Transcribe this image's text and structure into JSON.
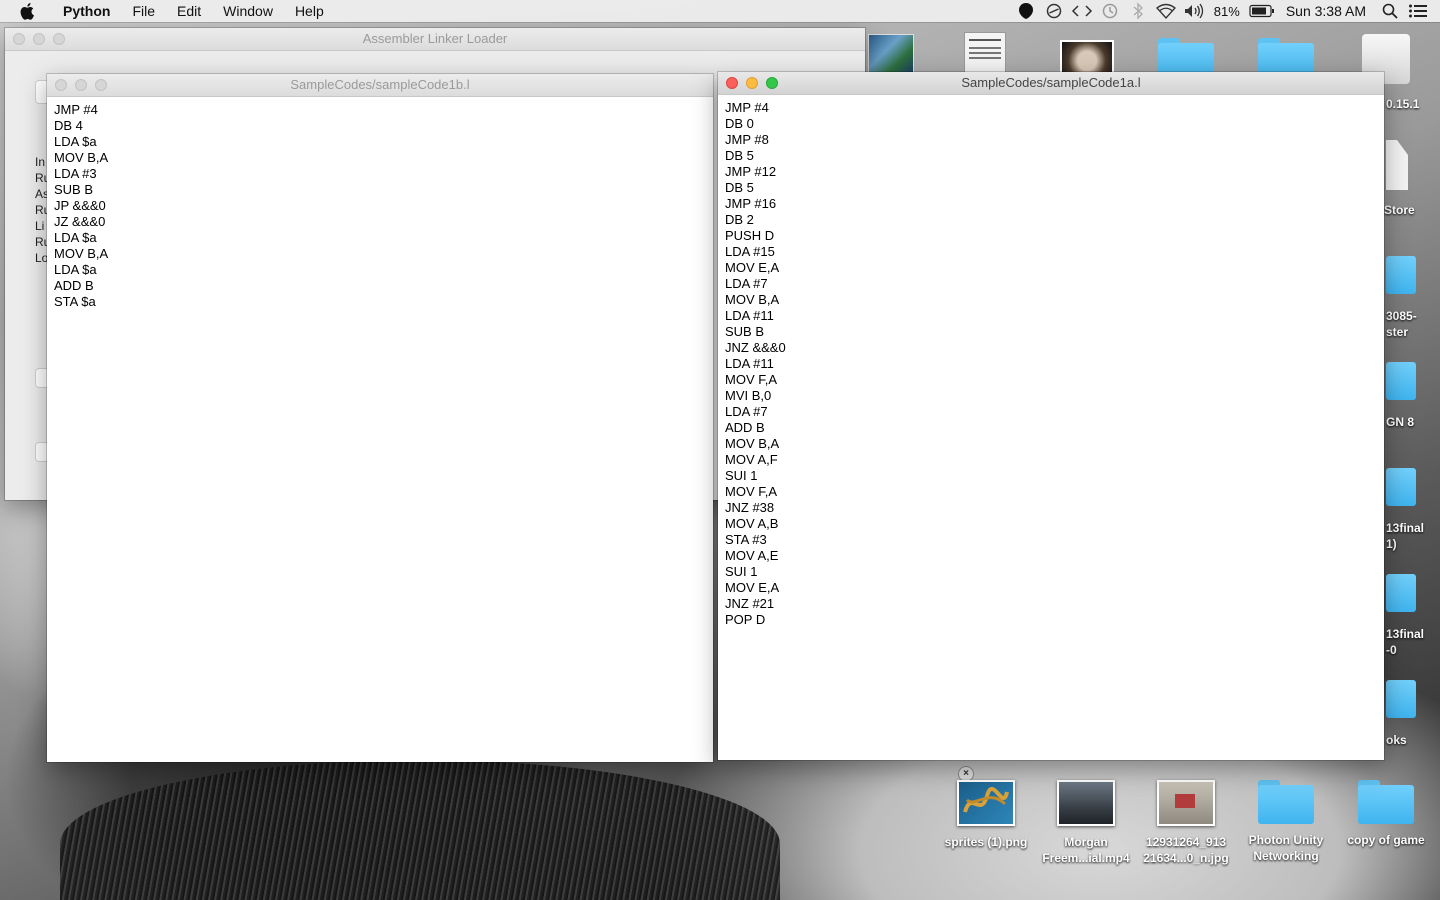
{
  "menubar": {
    "app_name": "Python",
    "menus": [
      "File",
      "Edit",
      "Window",
      "Help"
    ],
    "battery": "81%",
    "clock": "Sun 3:38 AM",
    "icons": [
      "apple-icon",
      "record-icon",
      "sync-icon",
      "code-brackets-icon",
      "time-machine-icon",
      "bluetooth-icon",
      "wifi-icon",
      "volume-icon",
      "battery-icon",
      "spotlight-icon",
      "notification-center-icon"
    ]
  },
  "background_window": {
    "title": "Assembler Linker Loader",
    "fragments": [
      "In",
      "Ru",
      "As",
      "Ru",
      "Li",
      "Ru",
      "Lo"
    ]
  },
  "window_b": {
    "title": "SampleCodes/sampleCode1b.l",
    "lines": [
      "JMP #4",
      "DB 4",
      "LDA $a",
      "MOV B,A",
      "LDA #3",
      "SUB B",
      "JP &&&0",
      "JZ &&&0",
      "LDA $a",
      "MOV B,A",
      "LDA $a",
      "ADD B",
      "STA $a"
    ]
  },
  "window_a": {
    "title": "SampleCodes/sampleCode1a.l",
    "lines": [
      "JMP #4",
      "DB 0",
      "JMP #8",
      "DB 5",
      "JMP #12",
      "DB 5",
      "JMP #16",
      "DB 2",
      "PUSH D",
      "LDA #15",
      "MOV E,A",
      "LDA #7",
      "MOV B,A",
      "LDA #11",
      "SUB B",
      "JNZ &&&0",
      "LDA #11",
      "MOV F,A",
      "MVI B,0",
      "LDA #7",
      "ADD B",
      "MOV B,A",
      "MOV A,F",
      "SUI 1",
      "MOV F,A",
      "JNZ #38",
      "MOV A,B",
      "STA #3",
      "MOV A,E",
      "SUI 1",
      "MOV E,A",
      "JNZ #21",
      "POP D"
    ]
  },
  "desktop": {
    "right_edge_labels": [
      "0.15.1",
      "Store",
      "3085-",
      "ster",
      "GN 8",
      "13final",
      "1)",
      "13final",
      "-0",
      "oks"
    ],
    "bottom_icons": [
      {
        "label1": "sprites (1).png",
        "label2": ""
      },
      {
        "label1": "Morgan",
        "label2": "Freem...ial.mp4"
      },
      {
        "label1": "12931264_913",
        "label2": "21634...0_n.jpg"
      },
      {
        "label1": "Photon Unity",
        "label2": "Networking"
      },
      {
        "label1": "copy of game",
        "label2": ""
      }
    ],
    "close_badge": "×"
  }
}
